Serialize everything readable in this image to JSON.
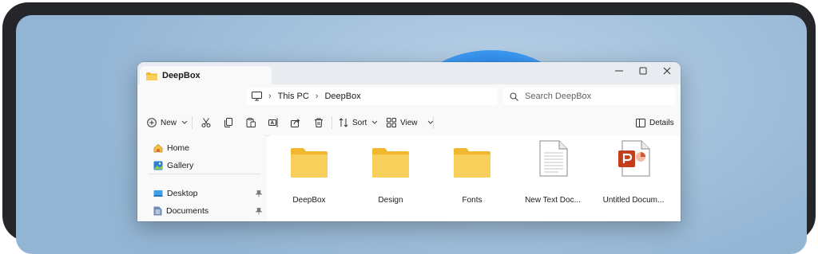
{
  "window": {
    "tab_title": "DeepBox",
    "controls": [
      "minimize",
      "maximize",
      "close"
    ]
  },
  "address": {
    "crumbs": [
      "This PC",
      "DeepBox"
    ],
    "root_icon": "monitor-icon"
  },
  "search": {
    "placeholder": "Search DeepBox"
  },
  "toolbar": {
    "new_label": "New",
    "sort_label": "Sort",
    "view_label": "View",
    "details_label": "Details",
    "actions": [
      "cut-icon",
      "copy-icon",
      "paste-icon",
      "rename-icon",
      "share-icon",
      "delete-icon"
    ]
  },
  "sidebar": {
    "items": [
      {
        "label": "Home",
        "icon": "home-icon",
        "pinned": false
      },
      {
        "label": "Gallery",
        "icon": "gallery-icon",
        "pinned": false
      },
      {
        "label": "Desktop",
        "icon": "desktop-icon",
        "pinned": true
      },
      {
        "label": "Documents",
        "icon": "documents-icon",
        "pinned": true
      }
    ]
  },
  "files": [
    {
      "name": "DeepBox",
      "type": "folder"
    },
    {
      "name": "Design",
      "type": "folder"
    },
    {
      "name": "Fonts",
      "type": "folder"
    },
    {
      "name": "New Text Doc...",
      "type": "text-document"
    },
    {
      "name": "Untitled Docum...",
      "type": "powerpoint-document"
    }
  ],
  "colors": {
    "folder": "#f8cf5b",
    "folder_tab": "#f1b82f",
    "powerpoint": "#c43e1c",
    "accent": "#0a6ad6"
  }
}
